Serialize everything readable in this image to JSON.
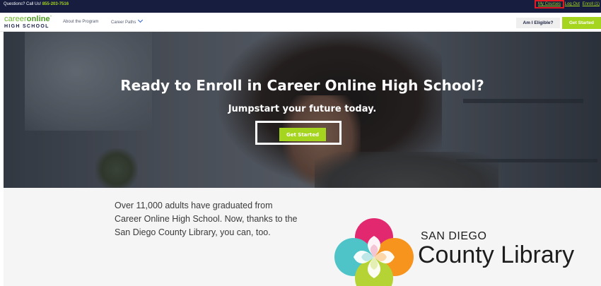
{
  "topbar": {
    "call_label": "Questions? Call Us!",
    "phone": "855-203-7516",
    "links": {
      "my_courses": "My Courses",
      "log_out": "Log Out",
      "enroll": "Enroll (1)"
    }
  },
  "nav": {
    "logo_line1_a": "career",
    "logo_line1_b": "online",
    "logo_line1_c": "°",
    "logo_line2": "HIGH SCHOOL",
    "about": "About the Program",
    "career_paths": "Career Paths",
    "am_i_eligible": "Am I Eligible?",
    "get_started": "Get Started"
  },
  "hero": {
    "title": "Ready to Enroll in Career Online High School?",
    "subtitle": "Jumpstart your future today.",
    "cta": "Get Started"
  },
  "lower": {
    "blurb": "Over 11,000 adults have graduated from Career Online High School. Now, thanks to the San Diego County Library, you can, too.",
    "library_line1": "SAN DIEGO",
    "library_line2": "County Library"
  },
  "colors": {
    "accent_green": "#a6d51f",
    "navy": "#161d3f",
    "highlight_red": "#e01b24"
  },
  "icons": {
    "career_paths_toggle": "chevron-down-icon",
    "library_logo": "flower-logo-icon"
  }
}
